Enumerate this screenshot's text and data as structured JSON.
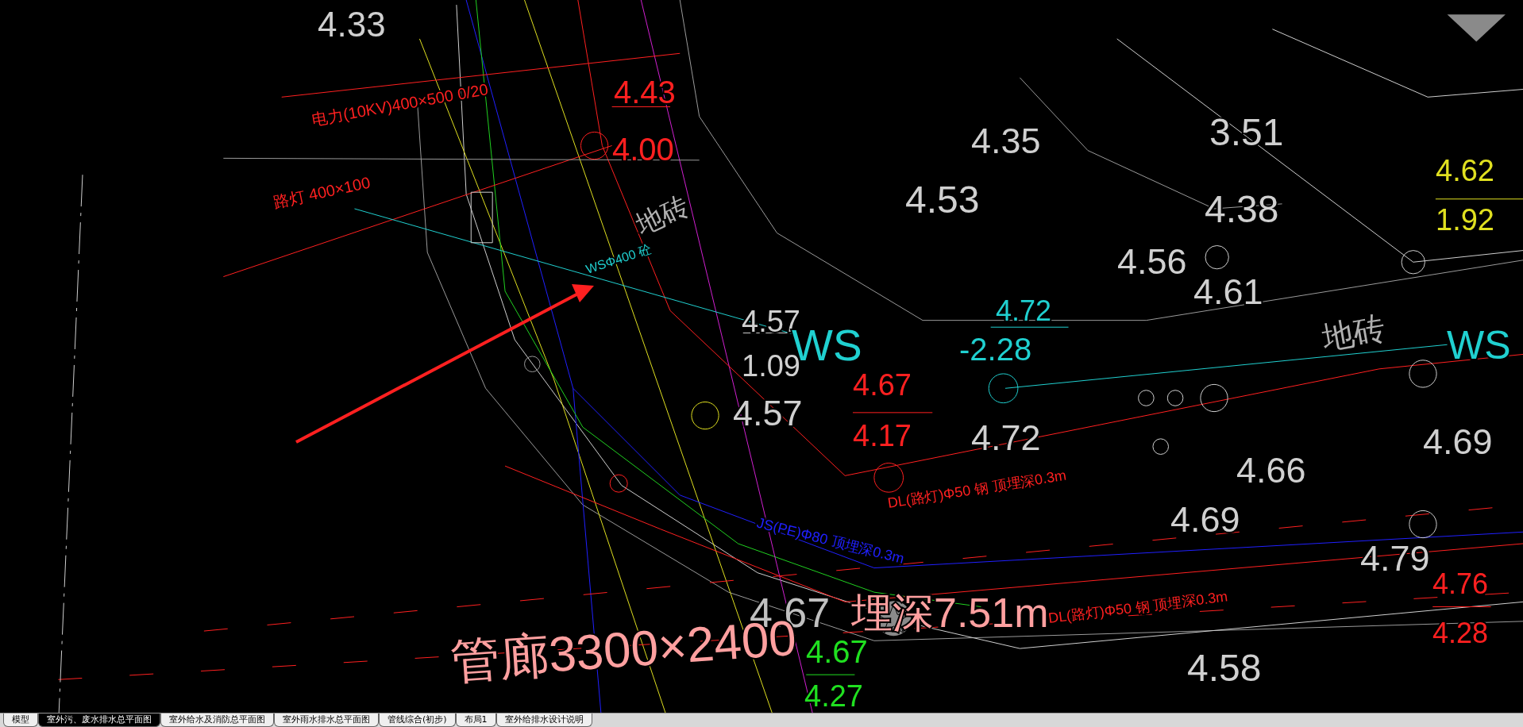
{
  "drawing": {
    "labels": [
      {
        "text": "4.33",
        "color": "#d0d0d0"
      },
      {
        "text": "电力(10KV)400×500 0/20",
        "color": "#ff2020"
      },
      {
        "text": "路灯 400×100",
        "color": "#ff2020"
      },
      {
        "text": "4.43",
        "color": "#ff2020"
      },
      {
        "text": "4.00",
        "color": "#ff2020"
      },
      {
        "text": "WSΦ400 砼",
        "color": "#20d0d0"
      },
      {
        "text": "地砖",
        "color": "#b0b0b0"
      },
      {
        "text": "4.57",
        "color": "#d0d0d0"
      },
      {
        "text": "1.09",
        "color": "#d0d0d0"
      },
      {
        "text": "WS",
        "color": "#20d0d0"
      },
      {
        "text": "4.57",
        "color": "#d0d0d0"
      },
      {
        "text": "4.35",
        "color": "#d0d0d0"
      },
      {
        "text": "4.53",
        "color": "#d0d0d0"
      },
      {
        "text": "3.51",
        "color": "#d0d0d0"
      },
      {
        "text": "4.38",
        "color": "#d0d0d0"
      },
      {
        "text": "4.56",
        "color": "#d0d0d0"
      },
      {
        "text": "4.61",
        "color": "#d0d0d0"
      },
      {
        "text": "4.62",
        "color": "#e0e020"
      },
      {
        "text": "1.92",
        "color": "#e0e020"
      },
      {
        "text": "4.72",
        "color": "#20d0d0"
      },
      {
        "text": "-2.28",
        "color": "#20d0d0"
      },
      {
        "text": "地砖",
        "color": "#b0b0b0"
      },
      {
        "text": "WS",
        "color": "#20d0d0"
      },
      {
        "text": "4.67",
        "color": "#ff2020"
      },
      {
        "text": "4.17",
        "color": "#ff2020"
      },
      {
        "text": "4.72",
        "color": "#d0d0d0"
      },
      {
        "text": "DL(路灯)Φ50 钢 顶埋深0.3m",
        "color": "#ff2020"
      },
      {
        "text": "4.66",
        "color": "#d0d0d0"
      },
      {
        "text": "4.69",
        "color": "#d0d0d0"
      },
      {
        "text": "4.69",
        "color": "#d0d0d0"
      },
      {
        "text": "JS(PE)Φ80 顶埋深0.3m",
        "color": "#2020ff"
      },
      {
        "text": "4.79",
        "color": "#d0d0d0"
      },
      {
        "text": "4.76",
        "color": "#ff2020"
      },
      {
        "text": "4.28",
        "color": "#ff2020"
      },
      {
        "text": "DL(路灯)Φ50 钢 顶埋深0.3m",
        "color": "#ff2020"
      },
      {
        "text": "4.67",
        "color": "#c0c0c0"
      },
      {
        "text": "埋深7.51m",
        "color": "#ffa0a0"
      },
      {
        "text": "管廊3300×2400",
        "color": "#ffa0a0"
      },
      {
        "text": "4.67",
        "color": "#20e020"
      },
      {
        "text": "4.27",
        "color": "#20e020"
      },
      {
        "text": "4.58",
        "color": "#d0d0d0"
      }
    ]
  },
  "layout_tabs": [
    {
      "label": "模型",
      "selected": false
    },
    {
      "label": "室外污、废水排水总平面图",
      "selected": true
    },
    {
      "label": "室外给水及消防总平面图",
      "selected": false
    },
    {
      "label": "室外雨水排水总平面图",
      "selected": false
    },
    {
      "label": "管线综合(初步)",
      "selected": false
    },
    {
      "label": "布局1",
      "selected": false
    },
    {
      "label": "室外给排水设计说明",
      "selected": false
    }
  ]
}
